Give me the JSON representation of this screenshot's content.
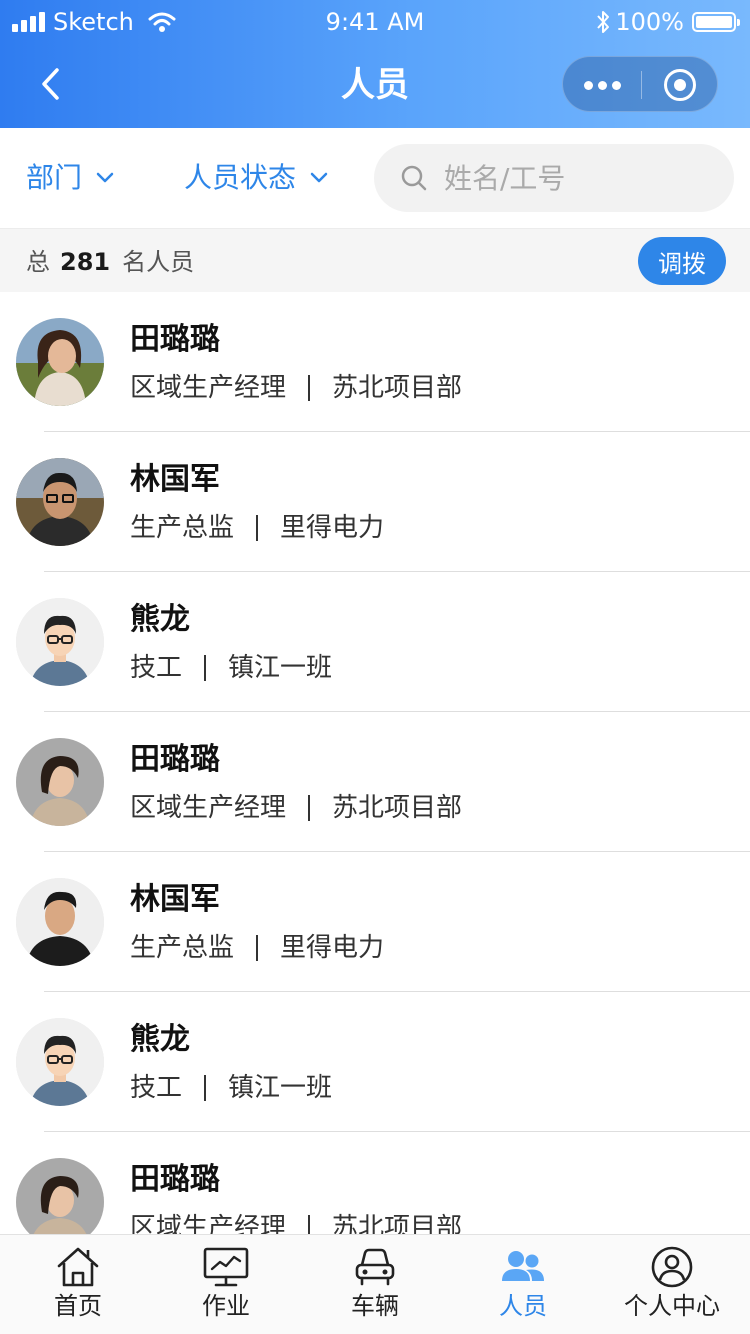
{
  "status_bar": {
    "carrier": "Sketch",
    "time": "9:41 AM",
    "battery": "100%",
    "battery_level": 1.0
  },
  "nav": {
    "title": "人员"
  },
  "filters": {
    "department_label": "部门",
    "status_label": "人员状态",
    "search_placeholder": "姓名/工号",
    "search_value": ""
  },
  "summary": {
    "prefix": "总",
    "count": "281",
    "suffix": "名人员",
    "transfer_label": "调拨"
  },
  "people": [
    {
      "name": "田璐璐",
      "role": "区域生产经理",
      "unit": "苏北项目部",
      "avatar": "avatar-woman-outdoor"
    },
    {
      "name": "林国军",
      "role": "生产总监",
      "unit": "里得电力",
      "avatar": "avatar-man-glasses"
    },
    {
      "name": "熊龙",
      "role": "技工",
      "unit": "镇江一班",
      "avatar": "avatar-man-illustrated"
    },
    {
      "name": "田璐璐",
      "role": "区域生产经理",
      "unit": "苏北项目部",
      "avatar": "avatar-woman-shorthair"
    },
    {
      "name": "林国军",
      "role": "生产总监",
      "unit": "里得电力",
      "avatar": "avatar-man-blackshirt"
    },
    {
      "name": "熊龙",
      "role": "技工",
      "unit": "镇江一班",
      "avatar": "avatar-man-illustrated"
    },
    {
      "name": "田璐璐",
      "role": "区域生产经理",
      "unit": "苏北项目部",
      "avatar": "avatar-woman-shorthair"
    }
  ],
  "tabs": [
    {
      "label": "首页",
      "icon": "home-icon",
      "active": false
    },
    {
      "label": "作业",
      "icon": "monitor-chart-icon",
      "active": false
    },
    {
      "label": "车辆",
      "icon": "car-icon",
      "active": false
    },
    {
      "label": "人员",
      "icon": "people-icon",
      "active": true
    },
    {
      "label": "个人中心",
      "icon": "user-circle-icon",
      "active": false
    }
  ],
  "colors": {
    "primary": "#2e86e8",
    "header_start": "#2f7cf0",
    "header_end": "#79b9fd"
  }
}
